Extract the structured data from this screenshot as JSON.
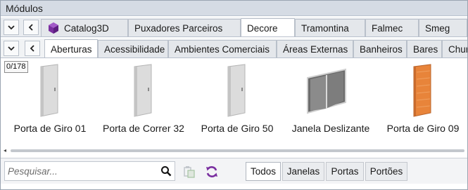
{
  "window": {
    "title": "Módulos"
  },
  "top_tabs": [
    {
      "label": "Catalog3D",
      "icon": "catalog3d-cube-icon"
    },
    {
      "label": "Puxadores Parceiros"
    },
    {
      "label": "Decore",
      "active": true
    },
    {
      "label": "Tramontina"
    },
    {
      "label": "Falmec"
    },
    {
      "label": "Smeg"
    }
  ],
  "category_tabs": [
    {
      "label": "Aberturas",
      "active": true
    },
    {
      "label": "Acessibilidade"
    },
    {
      "label": "Ambientes Comerciais"
    },
    {
      "label": "Áreas Externas"
    },
    {
      "label": "Banheiros"
    },
    {
      "label": "Bares"
    },
    {
      "label": "Chur"
    }
  ],
  "counter": "0/178",
  "items": [
    {
      "label": "Porta de Giro 01",
      "thumb": "white-door"
    },
    {
      "label": "Porta de Correr 32",
      "thumb": "white-door"
    },
    {
      "label": "Porta de Giro 50",
      "thumb": "white-door"
    },
    {
      "label": "Janela Deslizante",
      "thumb": "sliding-window"
    },
    {
      "label": "Porta de Giro 09",
      "thumb": "wood-door"
    }
  ],
  "search": {
    "placeholder": "Pesquisar..."
  },
  "filters": [
    {
      "label": "Todos",
      "active": true
    },
    {
      "label": "Janelas"
    },
    {
      "label": "Portas"
    },
    {
      "label": "Portões"
    }
  ],
  "colors": {
    "accent_purple": "#7a2fa0",
    "wood": "#e8843a",
    "titlebar": "#d5dbe4"
  }
}
